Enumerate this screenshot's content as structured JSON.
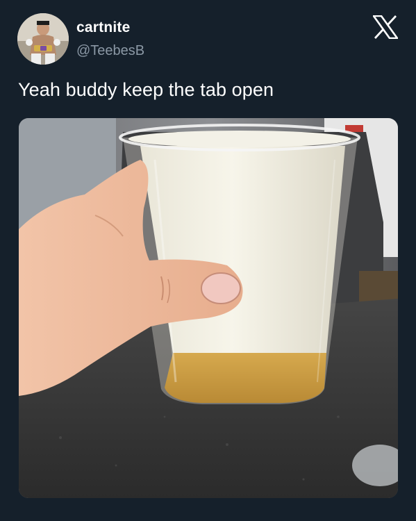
{
  "tweet": {
    "display_name": "cartnite",
    "handle": "@TeebesB",
    "text": "Yeah buddy keep the tab open"
  },
  "icons": {
    "platform_logo": "x-logo-icon",
    "avatar": "profile-photo"
  },
  "media": {
    "subject": "hand-holding-plastic-cup-of-foamy-beer"
  },
  "colors": {
    "background": "#15202b",
    "primary_text": "#ffffff",
    "secondary_text": "#8b98a5"
  }
}
